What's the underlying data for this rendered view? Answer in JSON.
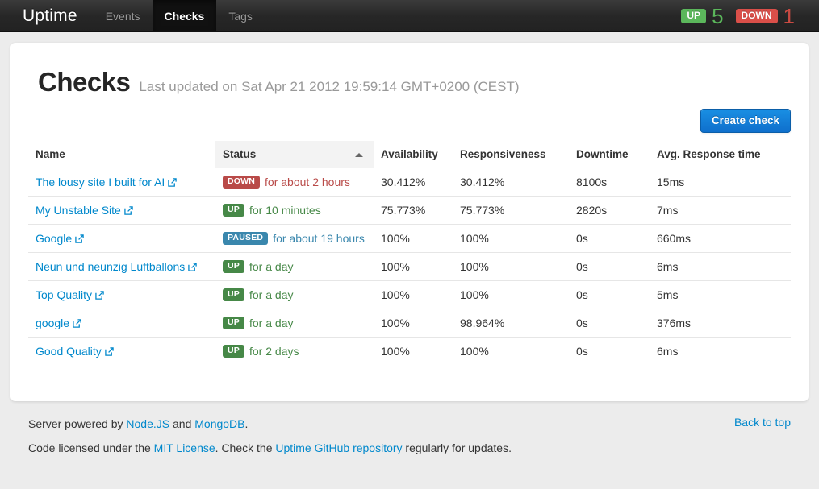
{
  "navbar": {
    "brand": "Uptime",
    "items": [
      {
        "label": "Events",
        "active": false
      },
      {
        "label": "Checks",
        "active": true
      },
      {
        "label": "Tags",
        "active": false
      }
    ],
    "status": {
      "up_label": "UP",
      "up_count": "5",
      "down_label": "DOWN",
      "down_count": "1",
      "up_color": "#5bb75b",
      "down_color": "#da4f49"
    }
  },
  "header": {
    "title": "Checks",
    "subtitle": "Last updated on Sat Apr 21 2012 19:59:14 GMT+0200 (CEST)"
  },
  "toolbar": {
    "create_label": "Create check",
    "accent_color": "#0f6fcc"
  },
  "table": {
    "columns": [
      {
        "label": "Name",
        "sorted": false
      },
      {
        "label": "Status",
        "sorted": true,
        "sort_dir": "asc"
      },
      {
        "label": "Availability",
        "sorted": false
      },
      {
        "label": "Responsiveness",
        "sorted": false
      },
      {
        "label": "Downtime",
        "sorted": false
      },
      {
        "label": "Avg. Response time",
        "sorted": false
      }
    ],
    "rows": [
      {
        "name": "The lousy site I built for AI",
        "status_badge": "DOWN",
        "status_state": "down",
        "status_text": "for about 2 hours",
        "availability": "30.412%",
        "responsiveness": "30.412%",
        "downtime": "8100s",
        "avg_response": "15ms"
      },
      {
        "name": "My Unstable Site",
        "status_badge": "UP",
        "status_state": "up",
        "status_text": "for 10 minutes",
        "availability": "75.773%",
        "responsiveness": "75.773%",
        "downtime": "2820s",
        "avg_response": "7ms"
      },
      {
        "name": "Google",
        "status_badge": "PAUSED",
        "status_state": "paused",
        "status_text": "for about 19 hours",
        "availability": "100%",
        "responsiveness": "100%",
        "downtime": "0s",
        "avg_response": "660ms"
      },
      {
        "name": "Neun und neunzig Luftballons",
        "status_badge": "UP",
        "status_state": "up",
        "status_text": "for a day",
        "availability": "100%",
        "responsiveness": "100%",
        "downtime": "0s",
        "avg_response": "6ms"
      },
      {
        "name": "Top Quality",
        "status_badge": "UP",
        "status_state": "up",
        "status_text": "for a day",
        "availability": "100%",
        "responsiveness": "100%",
        "downtime": "0s",
        "avg_response": "5ms"
      },
      {
        "name": "google",
        "status_badge": "UP",
        "status_state": "up",
        "status_text": "for a day",
        "availability": "100%",
        "responsiveness": "98.964%",
        "downtime": "0s",
        "avg_response": "376ms"
      },
      {
        "name": "Good Quality",
        "status_badge": "UP",
        "status_state": "up",
        "status_text": "for 2 days",
        "availability": "100%",
        "responsiveness": "100%",
        "downtime": "0s",
        "avg_response": "6ms"
      }
    ],
    "link_icon": "external-link-icon"
  },
  "footer": {
    "line1": {
      "pre": "Server powered by ",
      "link1": "Node.JS",
      "mid": " and ",
      "link2": "MongoDB",
      "post": "."
    },
    "line2": {
      "pre": "Code licensed under the ",
      "link1": "MIT License",
      "mid": ". Check the ",
      "link2": "Uptime GitHub repository",
      "post": " regularly for updates."
    },
    "back_to_top": "Back to top"
  }
}
